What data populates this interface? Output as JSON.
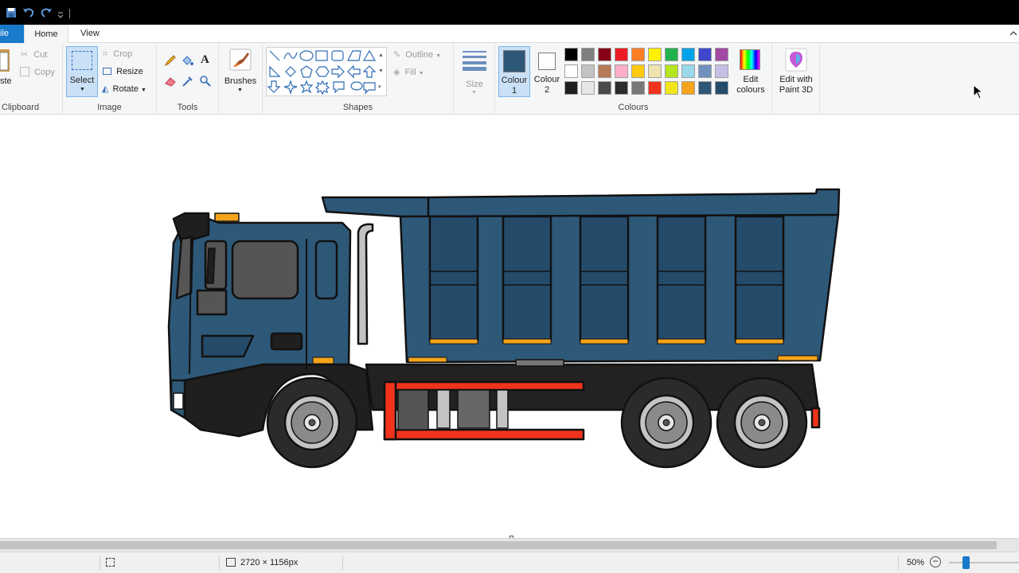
{
  "app": {
    "title": ""
  },
  "tabs": {
    "file": "ile",
    "home": "Home",
    "view": "View"
  },
  "clipboard": {
    "paste": "ste",
    "cut": "Cut",
    "copy": "Copy",
    "label": "Clipboard"
  },
  "image": {
    "select": "Select",
    "crop": "Crop",
    "resize": "Resize",
    "rotate": "Rotate",
    "label": "Image"
  },
  "tools": {
    "label": "Tools",
    "text_tool": "A"
  },
  "brushes": {
    "label": "Brushes"
  },
  "shapes": {
    "outline": "Outline",
    "fill": "Fill",
    "label": "Shapes"
  },
  "size": {
    "label": "Size"
  },
  "colours": {
    "colour1_label": "Colour\n1",
    "colour1_l1": "Colour",
    "colour1_l2": "1",
    "colour2_l1": "Colour",
    "colour2_l2": "2",
    "colour1_value": "#2e5878",
    "colour2_value": "#ffffff",
    "edit_l1": "Edit",
    "edit_l2": "colours",
    "label": "Colours",
    "palette": [
      [
        "#000000",
        "#7f7f7f",
        "#880015",
        "#ed1c24",
        "#ff7f27",
        "#fff200",
        "#22b14c",
        "#00a2e8",
        "#3f48cc",
        "#a349a4"
      ],
      [
        "#ffffff",
        "#c3c3c3",
        "#b97a57",
        "#ffaec9",
        "#ffc90e",
        "#efe4b0",
        "#b5e61d",
        "#99d9ea",
        "#7092be",
        "#c8bfe7"
      ],
      [
        "#1f1f1f",
        "#e6e6e6",
        "#4a4a4a",
        "#2b2b2b",
        "#777777",
        "#f0331c",
        "#f2e51b",
        "#f4a41b",
        "#2e5878",
        "#254b6b"
      ]
    ]
  },
  "paint3d": {
    "l1": "Edit with",
    "l2": "Paint 3D"
  },
  "status": {
    "dimensions": "2720 × 1156px",
    "zoom": "50%"
  }
}
